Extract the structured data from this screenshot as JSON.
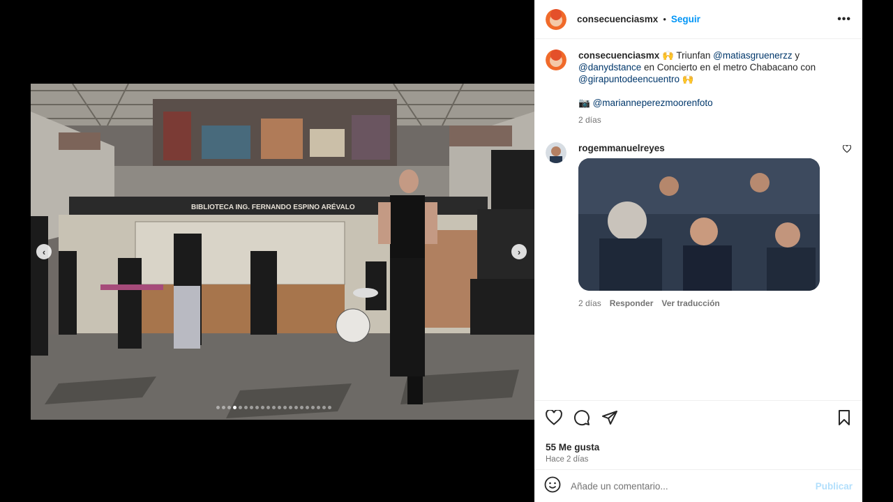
{
  "post": {
    "username": "consecuenciasmx",
    "separator": "•",
    "follow_label": "Seguir",
    "more_label": "•••",
    "image_alt": "Concierto en el metro Chabacano",
    "banner_text": "BIBLIOTECA ING. FERNANDO ESPINO ARÉVALO",
    "carousel": {
      "total": 21,
      "active": 4
    }
  },
  "caption": {
    "username": "consecuenciasmx",
    "emoji": "🙌",
    "text_1": " Triunfan ",
    "mention_1": "@matiasgruenerzz",
    "text_2": " y ",
    "mention_2": "@danydstance",
    "text_3": " en Concierto en el metro Chabacano con ",
    "mention_3": "@girapuntodeencuentro",
    "credit_icon": "📷",
    "credit_mention": "@marianneperezmoorenfoto",
    "time": "2 días"
  },
  "reply": {
    "username": "rogemmanuelreyes",
    "time": "2 días",
    "reply_label": "Responder",
    "translate_label": "Ver traducción"
  },
  "stats": {
    "likes": "55 Me gusta",
    "ago": "Hace 2 días"
  },
  "composer": {
    "placeholder": "Añade un comentario...",
    "publish_label": "Publicar"
  },
  "colors": {
    "link": "#0095f6",
    "mention": "#00376b",
    "muted": "#737373"
  }
}
